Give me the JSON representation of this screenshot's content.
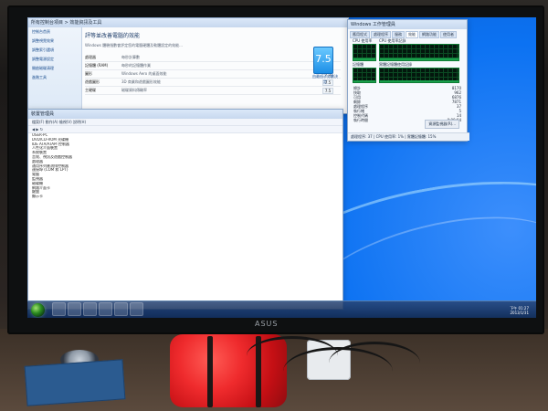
{
  "desktop": {
    "brand": "ASUS",
    "clock": {
      "time": "下午 01:27",
      "date": "2013/1/31"
    }
  },
  "system_window": {
    "title": "所有控制台項目 > 效能資訊及工具",
    "left_links": [
      "控制台首頁",
      "調整視覺效果",
      "調整索引選項",
      "調整電源設定",
      "開啟磁碟清理",
      "進階工具"
    ],
    "heading": "評等並改善電腦的效能",
    "subtext": "Windows 體驗指數會評定您的電腦硬體及軟體設定的效能...",
    "score": "7.5",
    "score_caption": "由最低子分數決定",
    "rows": [
      {
        "name": "處理器",
        "desc": "每秒計算數",
        "score": "7.5"
      },
      {
        "name": "記憶體 (RAM)",
        "desc": "每秒的記憶體作業",
        "score": "7.5"
      },
      {
        "name": "圖形",
        "desc": "Windows Aero 的桌面效能",
        "score": "7.5"
      },
      {
        "name": "遊戲圖形",
        "desc": "3D 商業和遊戲圖形效能",
        "score": "7.5"
      },
      {
        "name": "主硬碟",
        "desc": "磁碟資料傳輸率",
        "score": "7.5"
      }
    ]
  },
  "device_manager": {
    "title": "裝置管理員",
    "menu": [
      "檔案(F)",
      "動作(A)",
      "檢視(V)",
      "說明(H)"
    ],
    "tree_root": "USER-PC",
    "tree_items": [
      "DVD/CD-ROM 光碟機",
      "IDE ATA/ATAPI 控制器",
      "人性化介面裝置",
      "系統裝置",
      "音效、視訊及遊戲控制器",
      "處理器",
      "通用序列匯流排控制器",
      "連接埠 (COM 和 LPT)",
      "電腦",
      "監視器",
      "磁碟機",
      "網路介面卡",
      "鍵盤",
      "顯示卡"
    ]
  },
  "task_manager": {
    "title": "Windows 工作管理員",
    "tabs": [
      "應用程式",
      "處理程序",
      "服務",
      "效能",
      "網路功能",
      "使用者"
    ],
    "labels": {
      "cpu_usage": "CPU 使用率",
      "cpu_history": "CPU 使用率記錄",
      "memory": "記憶體",
      "memory_history": "實體記憶體使用記錄"
    },
    "stats": [
      {
        "label": "總計",
        "value": "8170"
      },
      {
        "label": "快取",
        "value": "962"
      },
      {
        "label": "可用",
        "value": "6876"
      },
      {
        "label": "剩餘",
        "value": "7871"
      },
      {
        "label": "處理程序",
        "value": "37"
      },
      {
        "label": "執行緒",
        "value": "5"
      },
      {
        "label": "控制代碼",
        "value": "14"
      },
      {
        "label": "執行時間",
        "value": "0:00:04"
      }
    ],
    "button": "資源監視器(R)...",
    "status": "處理程序: 37 | CPU 使用率: 1% | 實體記憶體: 15%"
  }
}
